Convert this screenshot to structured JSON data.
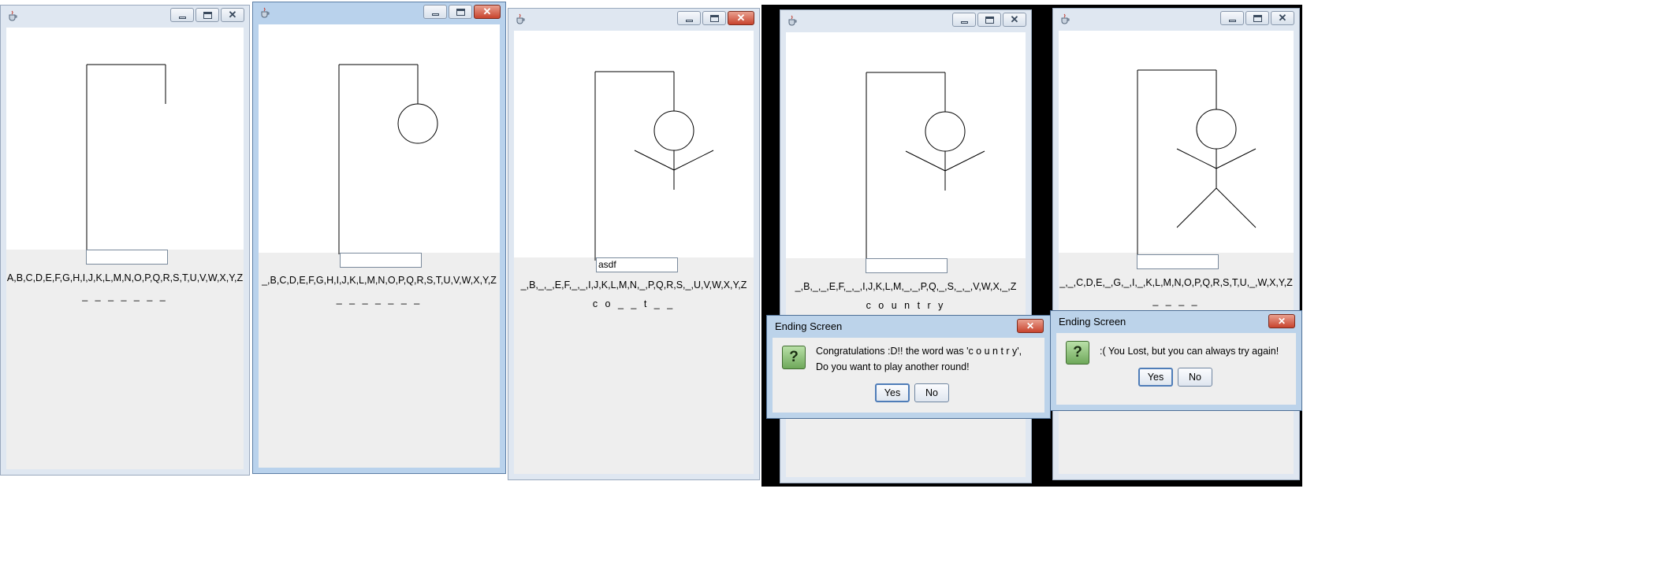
{
  "windows": [
    {
      "id": "w1",
      "guessed_letters": "A,B,C,D,E,F,G,H,I,J,K,L,M,N,O,P,Q,R,S,T,U,V,W,X,Y,Z",
      "word_display": "_ _ _ _ _ _ _",
      "input_value": "",
      "hangman_stage": "noose"
    },
    {
      "id": "w2",
      "guessed_letters": "_,B,C,D,E,F,G,H,I,J,K,L,M,N,O,P,Q,R,S,T,U,V,W,X,Y,Z",
      "word_display": "_ _ _ _ _ _ _",
      "input_value": "",
      "hangman_stage": "head"
    },
    {
      "id": "w3",
      "guessed_letters": "_,B,_,_,E,F,_,_,I,J,K,L,M,N,_,P,Q,R,S,_,U,V,W,X,Y,Z",
      "word_display": "c o _ _ t _ _",
      "input_value": "asdf",
      "hangman_stage": "head, arms, body"
    },
    {
      "id": "w4",
      "guessed_letters": "_,B,_,_,E,F,_,_,I,J,K,L,M,_,_,P,Q,_,S,_,_,V,W,X,_,Z",
      "word_display": "c o u n t r y",
      "input_value": "",
      "hangman_stage": "head, arms, body"
    },
    {
      "id": "w5",
      "guessed_letters": "_,_,C,D,E,_,G,_,I,_,K,L,M,N,O,P,Q,R,S,T,U,_,W,X,Y,Z",
      "word_display": "_ _ _ _",
      "input_value": "",
      "hangman_stage": "full"
    }
  ],
  "dialogs": [
    {
      "title": "Ending Screen",
      "line1": "Congratulations :D!! the word was 'c o u n t r y',",
      "line2": "Do you want to play another round!",
      "yes_label": "Yes",
      "no_label": "No",
      "icon": "question-icon"
    },
    {
      "title": "Ending Screen",
      "line1": ":( You Lost, but you can always try again!",
      "yes_label": "Yes",
      "no_label": "No",
      "icon": "question-icon"
    }
  ],
  "icons": {
    "app": "java-cup-icon",
    "minimize": "minimize-icon",
    "maximize": "maximize-icon",
    "close": "close-icon"
  },
  "colors": {
    "close_red": "#c8442e",
    "question_green": "#6ea85a"
  }
}
